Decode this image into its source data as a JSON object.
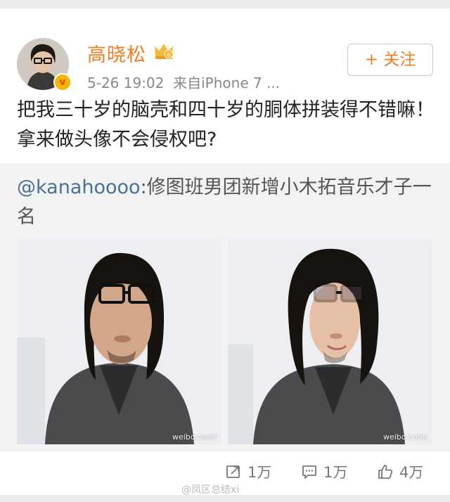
{
  "user": {
    "name": "高晓松",
    "time": "5-26 19:02",
    "source": "来自iPhone 7 ..."
  },
  "follow_label": "+ 关注",
  "post": {
    "text": "把我三十岁的脑壳和四十岁的胴体拼装得不错嘛！拿来做头像不会侵权吧?"
  },
  "repost": {
    "mention": "@kanahoooo",
    "text": ":修图班男团新增小木拓音乐才子一名",
    "watermark": "weibo.com/"
  },
  "actions": {
    "repost_count": "1万",
    "comment_count": "1万",
    "like_count": "4万"
  },
  "source_watermark": "@凤区总结xi",
  "colors": {
    "name": "#f07d1f",
    "mention": "#4a6f98",
    "repost_bg": "#f2f2f2"
  }
}
